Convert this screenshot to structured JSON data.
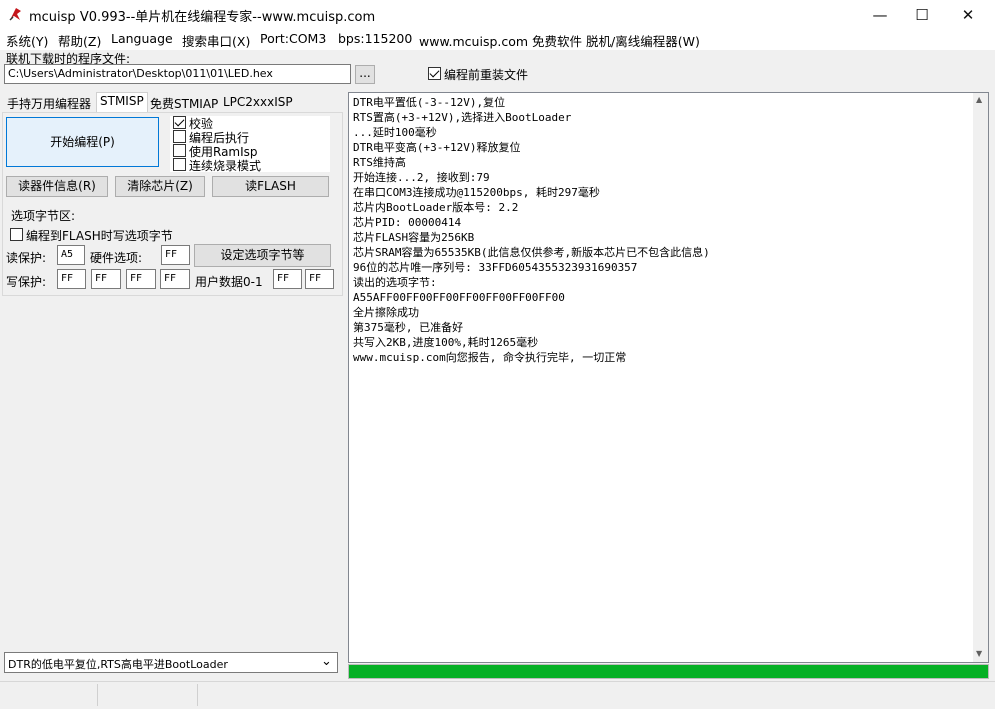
{
  "window": {
    "title": "mcuisp V0.993--单片机在线编程专家--www.mcuisp.com",
    "minimize": "—",
    "maximize": "☐",
    "close": "✕"
  },
  "menu": {
    "system": "系统(Y)",
    "help": "帮助(Z)",
    "language": "Language",
    "search_port": "搜索串口(X)",
    "port": "Port:COM3",
    "bps": "bps:115200",
    "website": "www.mcuisp.com 免费软件 脱机/离线编程器(W)"
  },
  "file": {
    "label": "联机下载时的程序文件:",
    "path": "C:\\Users\\Administrator\\Desktop\\011\\01\\LED.hex",
    "browse": "...",
    "reload_label": "编程前重装文件",
    "reload_checked": true
  },
  "tabs": [
    "手持万用编程器",
    "STMISP",
    "免费STMIAP",
    "LPC2xxxISP"
  ],
  "stmisp": {
    "start_button": "开始编程(P)",
    "options": [
      {
        "label": "校验",
        "checked": true
      },
      {
        "label": "编程后执行",
        "checked": false
      },
      {
        "label": "使用RamIsp",
        "checked": false
      },
      {
        "label": "连续烧录模式",
        "checked": false
      }
    ],
    "read_info_button": "读器件信息(R)",
    "erase_button": "清除芯片(Z)",
    "read_flash_button": "读FLASH",
    "option_bytes": {
      "group_label": "选项字节区:",
      "write_on_program": "编程到FLASH时写选项字节",
      "read_protect_label": "读保护:",
      "read_protect_value": "A5",
      "hw_option_label": "硬件选项:",
      "hw_option_value": "FF",
      "set_button": "设定选项字节等",
      "write_protect_label": "写保护:",
      "write_protect_values": [
        "FF",
        "FF",
        "FF",
        "FF"
      ],
      "user_data_label": "用户数据0-1",
      "user_data_values": [
        "FF",
        "FF"
      ]
    }
  },
  "dropdown": {
    "value": "DTR的低电平复位,RTS高电平进BootLoader"
  },
  "log": {
    "lines": [
      "DTR电平置低(-3--12V),复位",
      "RTS置高(+3-+12V),选择进入BootLoader",
      "...延时100毫秒",
      "DTR电平变高(+3-+12V)释放复位",
      "RTS维持高",
      "开始连接...2, 接收到:79",
      "在串口COM3连接成功@115200bps, 耗时297毫秒",
      "芯片内BootLoader版本号: 2.2",
      "芯片PID: 00000414",
      "芯片FLASH容量为256KB",
      "芯片SRAM容量为65535KB(此信息仅供参考,新版本芯片已不包含此信息)",
      "96位的芯片唯一序列号: 33FFD6054355323931690357",
      "读出的选项字节:",
      "A55AFF00FF00FF00FF00FF00FF00FF00",
      "全片擦除成功",
      "第375毫秒, 已准备好",
      "共写入2KB,进度100%,耗时1265毫秒",
      "www.mcuisp.com向您报告, 命令执行完毕, 一切正常"
    ]
  },
  "progress": {
    "fraction": 1.0,
    "color": "#06b025"
  },
  "icons": {
    "app": "mcuisp-logo-icon",
    "scroll_up": "▲",
    "scroll_down": "▼",
    "dropdown_arrow": "⌄"
  }
}
